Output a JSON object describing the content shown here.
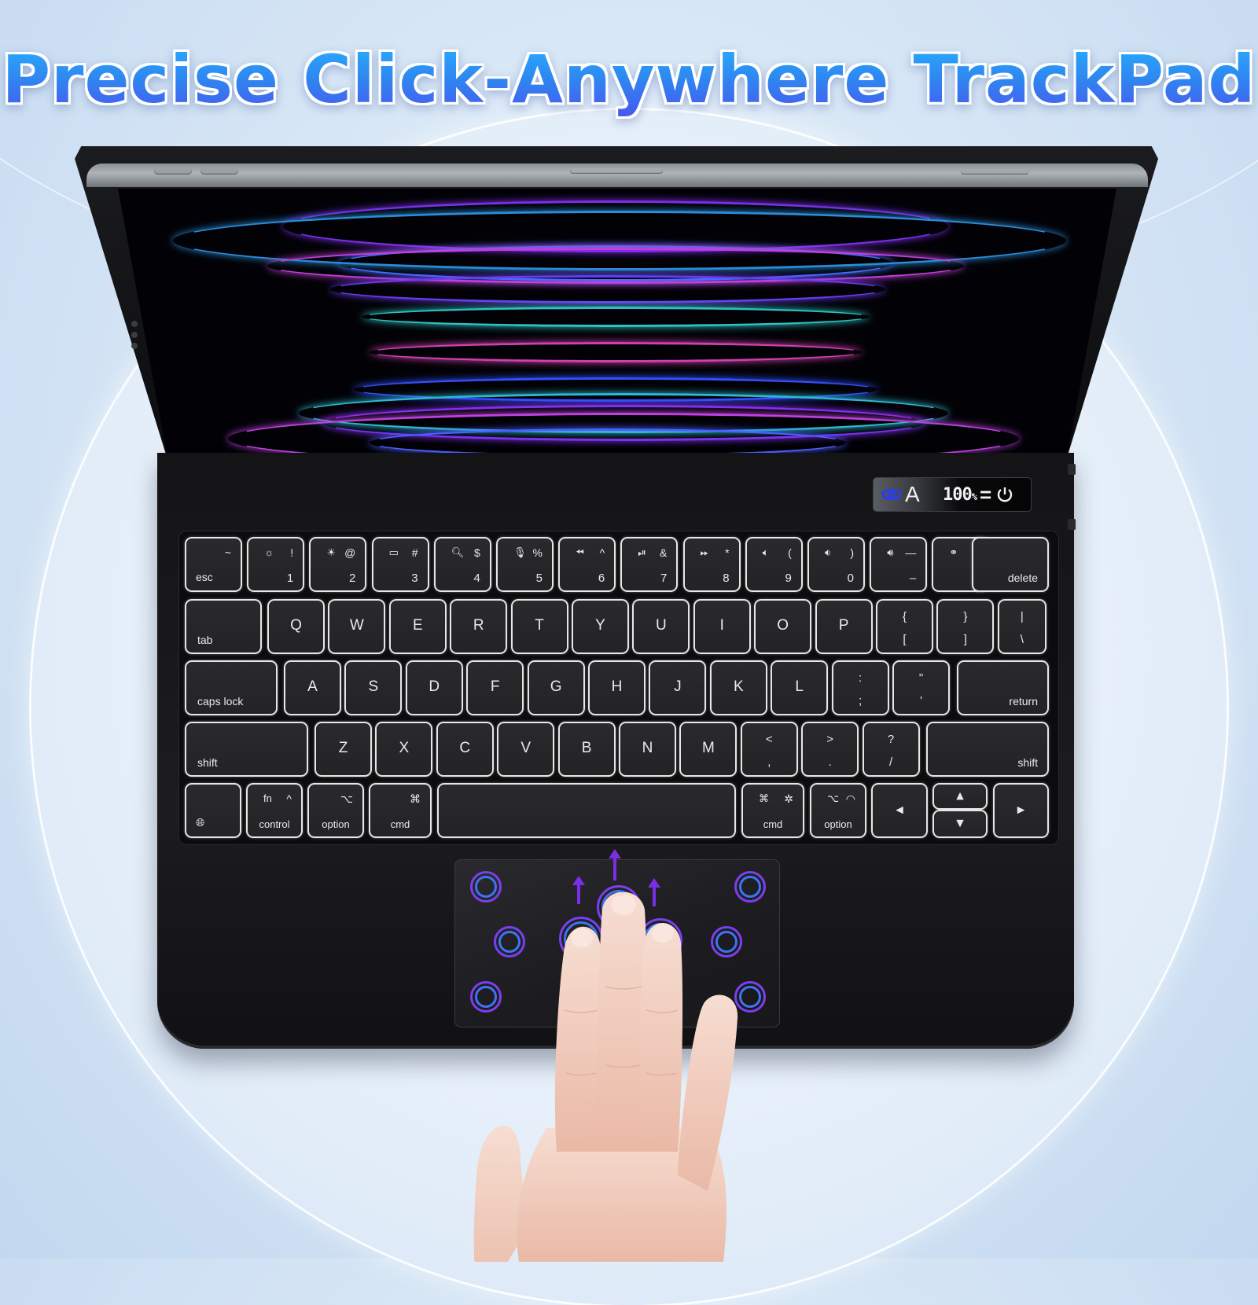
{
  "headline": "Precise Click-Anywhere TrackPad",
  "colors": {
    "headline_gradient_top": "#27b0ff",
    "headline_gradient_bottom": "#4a55f0",
    "key_backlight": "#e6e6e6",
    "trackpad_ring_outer": "#7b3ef0",
    "trackpad_ring_inner": "#3f73f5",
    "gesture_arrow": "#7a2ee6",
    "status_link_icon": "#2a3cf5"
  },
  "status_display": {
    "link_icon": "bluetooth-link-icon",
    "mode": "A",
    "battery": "100",
    "battery_unit": "%",
    "separator": "=",
    "power_icon": "power-icon"
  },
  "keyboard": {
    "row1": [
      {
        "id": "esc",
        "top": "~",
        "bl": "esc",
        "br": "`"
      },
      {
        "id": "1",
        "icon": "☼",
        "top": "!",
        "bottom": "1"
      },
      {
        "id": "2",
        "icon": "☀",
        "top": "@",
        "bottom": "2"
      },
      {
        "id": "3",
        "icon": "▭",
        "top": "#",
        "bottom": "3"
      },
      {
        "id": "4",
        "icon": "🔍︎",
        "top": "$",
        "bottom": "4"
      },
      {
        "id": "5",
        "icon": "🎙︎",
        "top": "%",
        "bottom": "5"
      },
      {
        "id": "6",
        "icon": "⏪︎",
        "top": "^",
        "bottom": "6"
      },
      {
        "id": "7",
        "icon": "⏯︎",
        "top": "&",
        "bottom": "7"
      },
      {
        "id": "8",
        "icon": "⏩︎",
        "top": "*",
        "bottom": "8"
      },
      {
        "id": "9",
        "icon": "🔈︎",
        "top": "(",
        "bottom": "9"
      },
      {
        "id": "0",
        "icon": "🔉︎",
        "top": ")",
        "bottom": "0"
      },
      {
        "id": "minus",
        "icon": "🔊︎",
        "top": "—",
        "bottom": "–"
      },
      {
        "id": "equals",
        "icon": "⚭",
        "top": "+",
        "bottom": "="
      },
      {
        "id": "delete",
        "label": "delete"
      }
    ],
    "row2": [
      {
        "id": "tab",
        "label": "tab"
      },
      {
        "id": "q",
        "label": "Q"
      },
      {
        "id": "w",
        "label": "W"
      },
      {
        "id": "e",
        "label": "E"
      },
      {
        "id": "r",
        "label": "R"
      },
      {
        "id": "t",
        "label": "T"
      },
      {
        "id": "y",
        "label": "Y"
      },
      {
        "id": "u",
        "label": "U"
      },
      {
        "id": "i",
        "label": "I"
      },
      {
        "id": "o",
        "label": "O"
      },
      {
        "id": "p",
        "label": "P"
      },
      {
        "id": "lbracket",
        "top": "{",
        "bottom": "["
      },
      {
        "id": "rbracket",
        "top": "}",
        "bottom": "]"
      },
      {
        "id": "backslash",
        "top": "|",
        "bottom": "\\"
      }
    ],
    "row3": [
      {
        "id": "capslock",
        "label": "caps lock"
      },
      {
        "id": "a",
        "label": "A"
      },
      {
        "id": "s",
        "label": "S"
      },
      {
        "id": "d",
        "label": "D"
      },
      {
        "id": "f",
        "label": "F"
      },
      {
        "id": "g",
        "label": "G"
      },
      {
        "id": "h",
        "label": "H"
      },
      {
        "id": "j",
        "label": "J"
      },
      {
        "id": "k",
        "label": "K"
      },
      {
        "id": "l",
        "label": "L"
      },
      {
        "id": "semicolon",
        "top": ":",
        "bottom": ";"
      },
      {
        "id": "quote",
        "top": "\"",
        "bottom": "'"
      },
      {
        "id": "return",
        "label": "return"
      }
    ],
    "row4": [
      {
        "id": "lshift",
        "label": "shift"
      },
      {
        "id": "z",
        "label": "Z"
      },
      {
        "id": "x",
        "label": "X"
      },
      {
        "id": "c",
        "label": "C"
      },
      {
        "id": "v",
        "label": "V"
      },
      {
        "id": "b",
        "label": "B"
      },
      {
        "id": "n",
        "label": "N"
      },
      {
        "id": "m",
        "label": "M"
      },
      {
        "id": "comma",
        "top": "<",
        "bottom": ","
      },
      {
        "id": "period",
        "top": ">",
        "bottom": "."
      },
      {
        "id": "slash",
        "top": "?",
        "bottom": "/"
      },
      {
        "id": "rshift",
        "label": "shift"
      }
    ],
    "row5": {
      "globe": {
        "icon": "🌐︎"
      },
      "control": {
        "top_left": "fn",
        "top_right": "^",
        "label": "control"
      },
      "loption": {
        "top": "⌥",
        "label": "option"
      },
      "lcmd": {
        "top": "⌘",
        "label": "cmd"
      },
      "space": {
        "label": ""
      },
      "rcmd": {
        "top_left": "⌘",
        "top_right": "✲",
        "label": "cmd"
      },
      "roption": {
        "top_left": "⌥",
        "top_right": "◠",
        "label": "option"
      },
      "left": {
        "label": "◂"
      },
      "up": {
        "label": "▴"
      },
      "down": {
        "label": "▾"
      },
      "right": {
        "label": "▸"
      }
    }
  },
  "trackpad": {
    "gesture": "three-finger swipe up",
    "touch_rings": 11,
    "arrows": 3
  }
}
